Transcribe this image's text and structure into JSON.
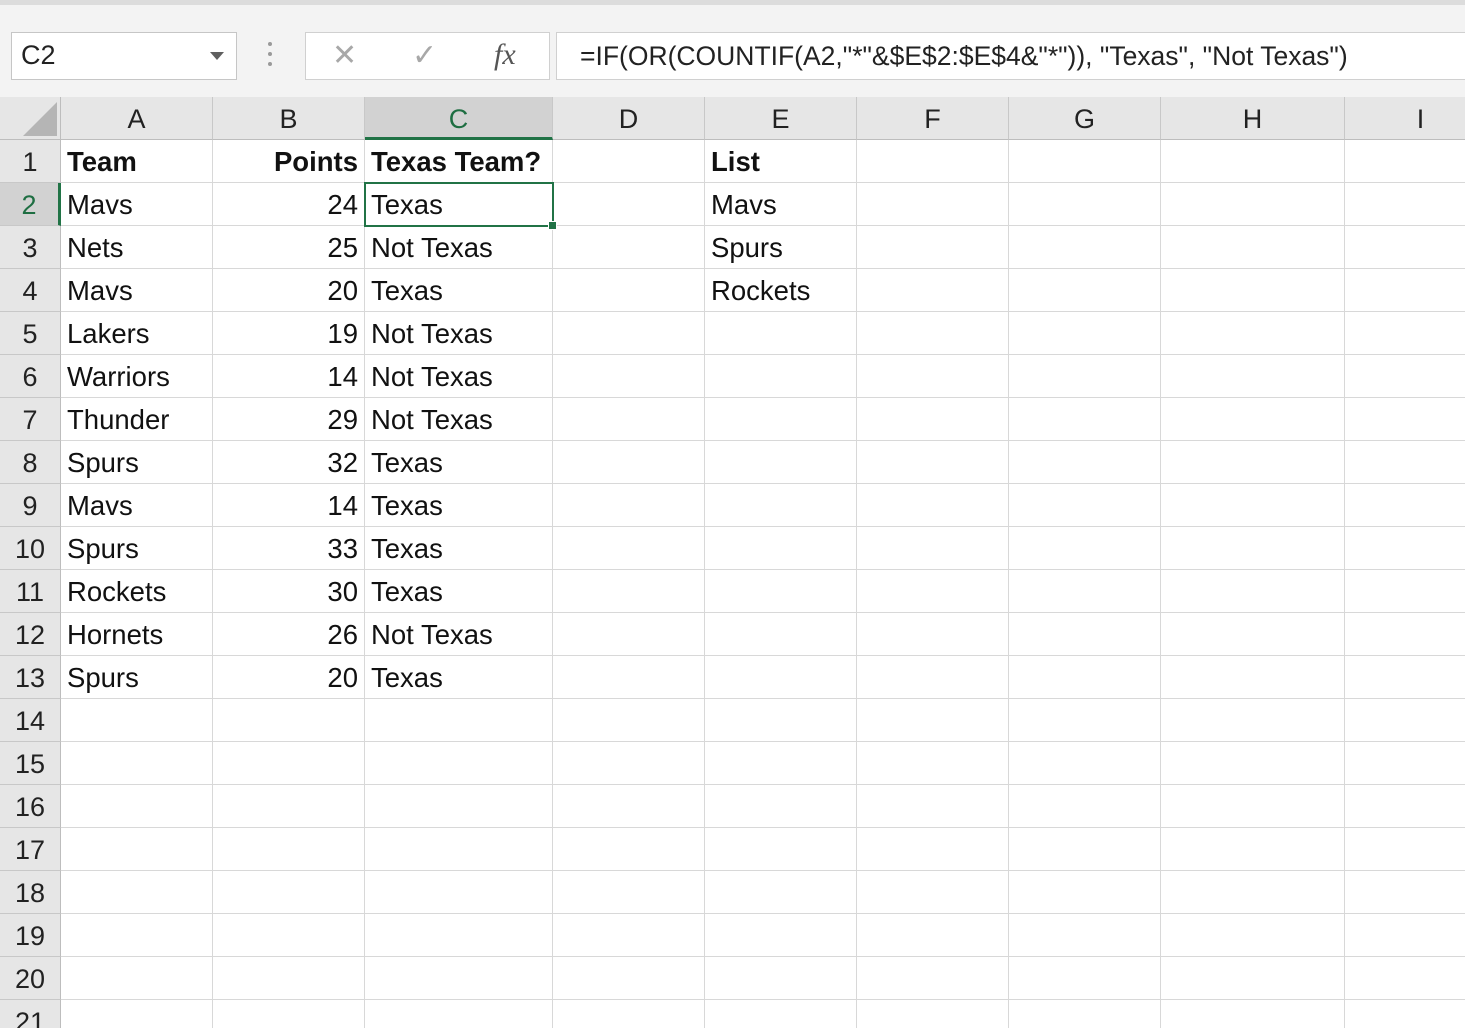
{
  "name_box": {
    "value": "C2"
  },
  "formula_bar": {
    "formula": "=IF(OR(COUNTIF(A2,\"*\"&$E$2:$E$4&\"*\")), \"Texas\", \"Not Texas\")",
    "cancel_glyph": "✕",
    "enter_glyph": "✓",
    "fx_label": "fx"
  },
  "columns": [
    "A",
    "B",
    "C",
    "D",
    "E",
    "F",
    "G",
    "H",
    "I"
  ],
  "rows": [
    "1",
    "2",
    "3",
    "4",
    "5",
    "6",
    "7",
    "8",
    "9",
    "10",
    "11",
    "12",
    "13",
    "14",
    "15",
    "16",
    "17",
    "18",
    "19",
    "20",
    "21"
  ],
  "selected_cell": {
    "column": "C",
    "row": "2"
  },
  "cells": {
    "A1": "Team",
    "B1": "Points",
    "C1": "Texas Team?",
    "E1": "List",
    "A2": "Mavs",
    "B2": "24",
    "C2": "Texas",
    "E2": "Mavs",
    "A3": "Nets",
    "B3": "25",
    "C3": "Not Texas",
    "E3": "Spurs",
    "A4": "Mavs",
    "B4": "20",
    "C4": "Texas",
    "E4": "Rockets",
    "A5": "Lakers",
    "B5": "19",
    "C5": "Not Texas",
    "A6": "Warriors",
    "B6": "14",
    "C6": "Not Texas",
    "A7": "Thunder",
    "B7": "29",
    "C7": "Not Texas",
    "A8": "Spurs",
    "B8": "32",
    "C8": "Texas",
    "A9": "Mavs",
    "B9": "14",
    "C9": "Texas",
    "A10": "Spurs",
    "B10": "33",
    "C10": "Texas",
    "A11": "Rockets",
    "B11": "30",
    "C11": "Texas",
    "A12": "Hornets",
    "B12": "26",
    "C12": "Not Texas",
    "A13": "Spurs",
    "B13": "20",
    "C13": "Texas"
  },
  "bold_cells": [
    "A1",
    "B1",
    "C1",
    "E1"
  ],
  "numeric_columns": [
    "B"
  ],
  "colors": {
    "accent_green": "#217346",
    "header_bg": "#e6e6e6",
    "gridline": "#d8d8d8"
  }
}
